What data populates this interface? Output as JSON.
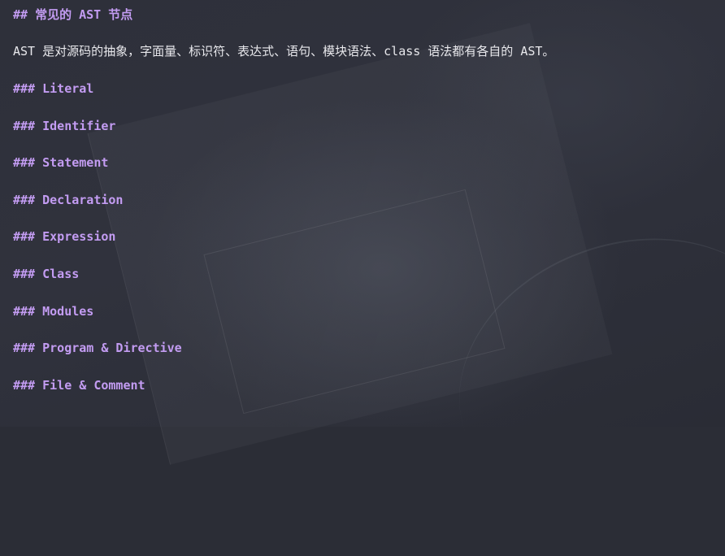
{
  "document": {
    "heading": "## 常见的 AST 节点",
    "paragraph": "AST 是对源码的抽象，字面量、标识符、表达式、语句、模块语法、class 语法都有各自的 AST。",
    "sections": [
      "### Literal",
      "### Identifier",
      "### Statement",
      "### Declaration",
      "### Expression",
      "### Class",
      "### Modules",
      "### Program & Directive",
      "### File & Comment"
    ]
  },
  "colors": {
    "heading": "#c39cf2",
    "text": "#e8e8ec",
    "background": "#2b2d36"
  }
}
